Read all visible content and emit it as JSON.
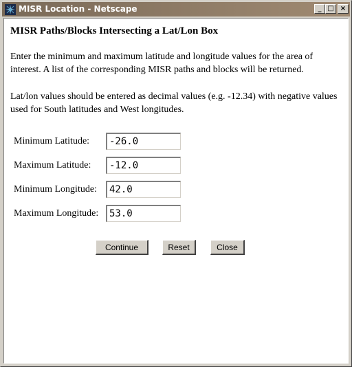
{
  "window": {
    "title": "MISR Location - Netscape",
    "icon": "netscape-icon",
    "controls": {
      "minimize": "_",
      "maximize": "□",
      "close": "×"
    }
  },
  "page": {
    "heading": "MISR Paths/Blocks Intersecting a Lat/Lon Box",
    "paragraph1": "Enter the minimum and maximum latitude and longitude values for the area of interest. A list of the corresponding MISR paths and blocks will be returned.",
    "paragraph2": "Lat/lon values should be entered as decimal values (e.g. -12.34) with negative values used for South latitudes and West longitudes."
  },
  "form": {
    "min_lat": {
      "label": "Minimum Latitude:",
      "value": "-26.0"
    },
    "max_lat": {
      "label": "Maximum Latitude:",
      "value": "-12.0"
    },
    "min_lon": {
      "label": "Minimum Longitude:",
      "value": "42.0"
    },
    "max_lon": {
      "label": "Maximum Longitude:",
      "value": "53.0"
    }
  },
  "buttons": {
    "continue": "Continue",
    "reset": "Reset",
    "close": "Close"
  },
  "colors": {
    "titlebar_start": "#7a6a58",
    "titlebar_end": "#a08a72",
    "chrome": "#d4d0c8",
    "content_bg": "#ffffff"
  }
}
